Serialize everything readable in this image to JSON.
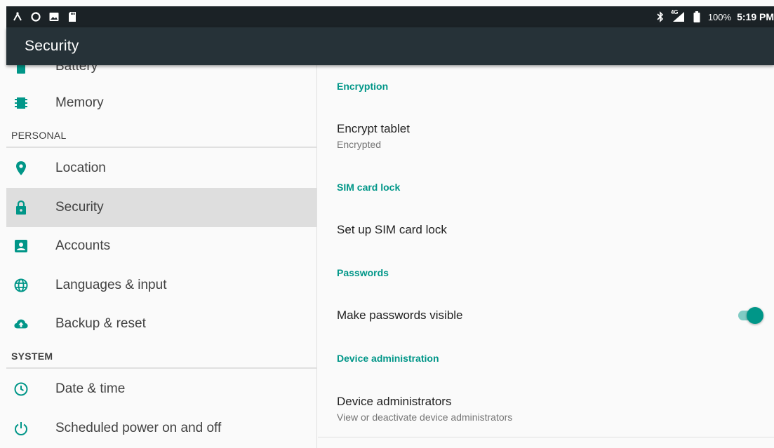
{
  "status_bar": {
    "left_icons": [
      "usb-icon",
      "sync-icon",
      "image-icon",
      "sd-card-icon"
    ],
    "right_icons": [
      "bluetooth-icon",
      "signal-4g-icon",
      "battery-icon"
    ],
    "network": "4G",
    "battery": "100%",
    "time": "5:19 PM"
  },
  "app_bar": {
    "title": "Security"
  },
  "sidebar": {
    "items_top": [
      {
        "label": "Battery",
        "icon": "battery-icon"
      },
      {
        "label": "Memory",
        "icon": "memory-icon"
      }
    ],
    "personal_header": "PERSONAL",
    "personal": [
      {
        "label": "Location",
        "icon": "location-icon"
      },
      {
        "label": "Security",
        "icon": "lock-icon",
        "selected": true
      },
      {
        "label": "Accounts",
        "icon": "account-icon"
      },
      {
        "label": "Languages & input",
        "icon": "globe-icon"
      },
      {
        "label": "Backup & reset",
        "icon": "cloud-upload-icon"
      }
    ],
    "system_header": "SYSTEM",
    "system": [
      {
        "label": "Date & time",
        "icon": "clock-icon"
      },
      {
        "label": "Scheduled power on and off",
        "icon": "power-icon"
      }
    ]
  },
  "content": {
    "encryption": {
      "header": "Encryption",
      "encrypt_title": "Encrypt tablet",
      "encrypt_summary": "Encrypted"
    },
    "sim": {
      "header": "SIM card lock",
      "setup_title": "Set up SIM card lock"
    },
    "passwords": {
      "header": "Passwords",
      "visible_title": "Make passwords visible",
      "visible_on": true
    },
    "device_admin": {
      "header": "Device administration",
      "admins_title": "Device administrators",
      "admins_summary": "View or deactivate device administrators"
    }
  },
  "colors": {
    "status_bar": "#1b2226",
    "app_bar": "#263238",
    "accent": "#009688",
    "accent_light": "#80cbc4",
    "selected_bg": "#dedede"
  }
}
